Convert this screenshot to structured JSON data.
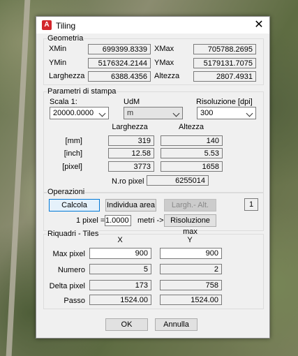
{
  "window": {
    "title": "Tiling",
    "app_icon_letter": "A",
    "close_glyph": "✕"
  },
  "geometria": {
    "label": "Geometria",
    "xmin_label": "XMin",
    "xmin": "699399.8339",
    "xmax_label": "XMax",
    "xmax": "705788.2695",
    "ymin_label": "YMin",
    "ymin": "5176324.2144",
    "ymax_label": "YMax",
    "ymax": "5179131.7075",
    "larghezza_label": "Larghezza",
    "larghezza": "6388.4356",
    "altezza_label": "Altezza",
    "altezza": "2807.4931"
  },
  "parametri": {
    "label": "Parametri di stampa",
    "scala_label": "Scala 1:",
    "scala_value": "20000.0000",
    "udm_label": "UdM",
    "udm_value": "m",
    "risoluzione_label": "Risoluzione [dpi]",
    "risoluzione_value": "300",
    "col_larghezza": "Larghezza",
    "col_altezza": "Altezza",
    "mm_label": "[mm]",
    "mm_w": "319",
    "mm_h": "140",
    "inch_label": "[inch]",
    "inch_w": "12.58",
    "inch_h": "5.53",
    "pixel_label": "[pixel]",
    "pixel_w": "3773",
    "pixel_h": "1658",
    "npixel_label": "N.ro pixel",
    "npixel": "6255014"
  },
  "operazioni": {
    "label": "Operazioni",
    "calcola": "Calcola",
    "individua": "Individua area",
    "largh_alt": "Largh.- Alt.",
    "count": "1",
    "pixel_eq_label": "1 pixel =",
    "pixel_eq_value": "1.0000",
    "metri_label": "metri ->",
    "risoluzione_max": "Risoluzione max"
  },
  "riquadri": {
    "label": "Riquadri - Tiles",
    "col_x": "X",
    "col_y": "Y",
    "max_pixel_label": "Max pixel",
    "max_pixel_x": "900",
    "max_pixel_y": "900",
    "numero_label": "Numero",
    "numero_x": "5",
    "numero_y": "2",
    "delta_label": "Delta pixel",
    "delta_x": "173",
    "delta_y": "758",
    "passo_label": "Passo",
    "passo_x": "1524.00",
    "passo_y": "1524.00"
  },
  "footer": {
    "ok": "OK",
    "annulla": "Annulla"
  }
}
